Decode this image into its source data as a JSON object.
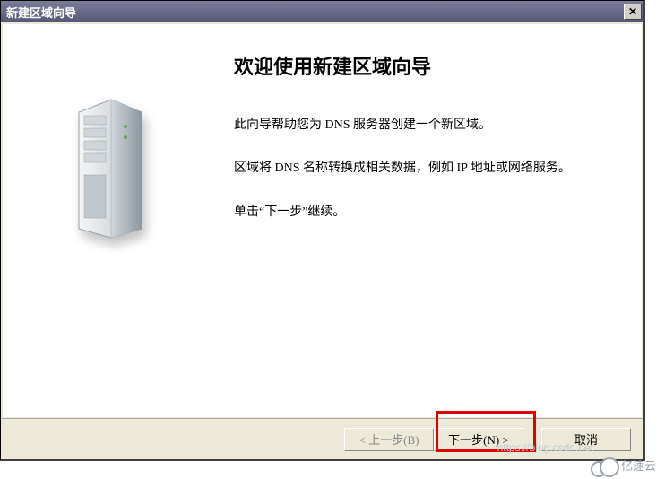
{
  "window": {
    "title": "新建区域向导",
    "close_glyph": "✕"
  },
  "wizard": {
    "heading": "欢迎使用新建区域向导",
    "p1": "此向导帮助您为 DNS 服务器创建一个新区域。",
    "p2": "区域将 DNS 名称转换成相关数据，例如 IP 地址或网络服务。",
    "p3": "单击“下一步”继续。"
  },
  "buttons": {
    "back": "< 上一步(B)",
    "next": "下一步(N) >",
    "cancel": "取消"
  },
  "watermark": {
    "text": "亿速云",
    "url": "https://blog.csdn.net"
  }
}
